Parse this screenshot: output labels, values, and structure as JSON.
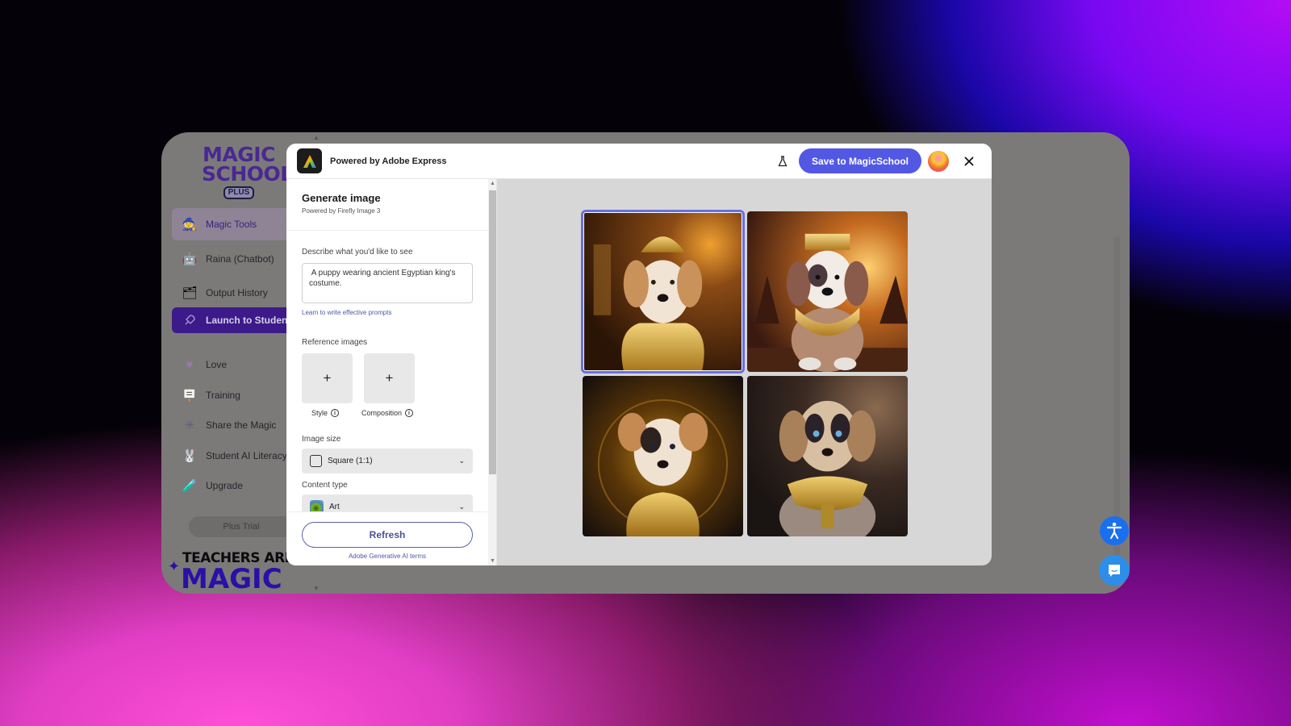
{
  "sidebar": {
    "logo": {
      "line1": "MAGIC",
      "line2": "SCHOOL",
      "badge": "PLUS"
    },
    "items": [
      {
        "label": "Magic Tools",
        "icon": "wizard-icon",
        "state": "active"
      },
      {
        "label": "Raina (Chatbot)",
        "icon": "robot-icon"
      },
      {
        "label": "Output History",
        "icon": "history-icon"
      },
      {
        "label": "Launch to Students",
        "icon": "rocket-icon",
        "state": "highlighted"
      },
      {
        "label": "Love",
        "icon": "heart-icon"
      },
      {
        "label": "Training",
        "icon": "easel-icon"
      },
      {
        "label": "Share the Magic",
        "icon": "sparkle-icon"
      },
      {
        "label": "Student AI Literacy",
        "icon": "bunny-icon"
      },
      {
        "label": "Upgrade",
        "icon": "potion-icon"
      }
    ],
    "plus_trial": "Plus Trial",
    "banner_line1": "TEACHERS ARE",
    "banner_line2": "MAGIC"
  },
  "modal": {
    "header": {
      "powered_by": "Powered by Adobe Express",
      "save_button": "Save to MagicSchool",
      "icons": [
        "adobe-express-logo",
        "flask-icon",
        "user-avatar",
        "close-icon"
      ]
    },
    "panel": {
      "title": "Generate image",
      "subtitle": "Powered by Firefly Image 3",
      "prompt_label": "Describe what you'd like to see",
      "prompt_value": " A puppy wearing ancient Egyptian king's costume.",
      "learn_link": "Learn to write effective prompts",
      "reference_label": "Reference images",
      "reference_slots": [
        {
          "caption": "Style",
          "add": "+"
        },
        {
          "caption": "Composition",
          "add": "+"
        }
      ],
      "image_size_label": "Image size",
      "image_size_value": "Square (1:1)",
      "content_type_label": "Content type",
      "content_type_value": "Art",
      "refresh_button": "Refresh",
      "terms_link": "Adobe Generative AI terms"
    },
    "results": {
      "selected_index": 0,
      "images": [
        {
          "alt": "Puppy in golden pharaoh headdress and collar, desert temple background"
        },
        {
          "alt": "Puppy with golden crown and collar, pyramids at sunset"
        },
        {
          "alt": "Puppy with golden Egyptian collar, glowing circular background"
        },
        {
          "alt": "Blue-eyed puppy with golden Egyptian collar, dark background"
        }
      ]
    }
  },
  "floating": {
    "accessibility": "accessibility-icon",
    "chat": "chat-icon"
  },
  "colors": {
    "accent": "#5258e4",
    "sidebar_highlight": "#3c1a8a",
    "link": "#4a5aa8",
    "a11y_button": "#1a6fef"
  }
}
